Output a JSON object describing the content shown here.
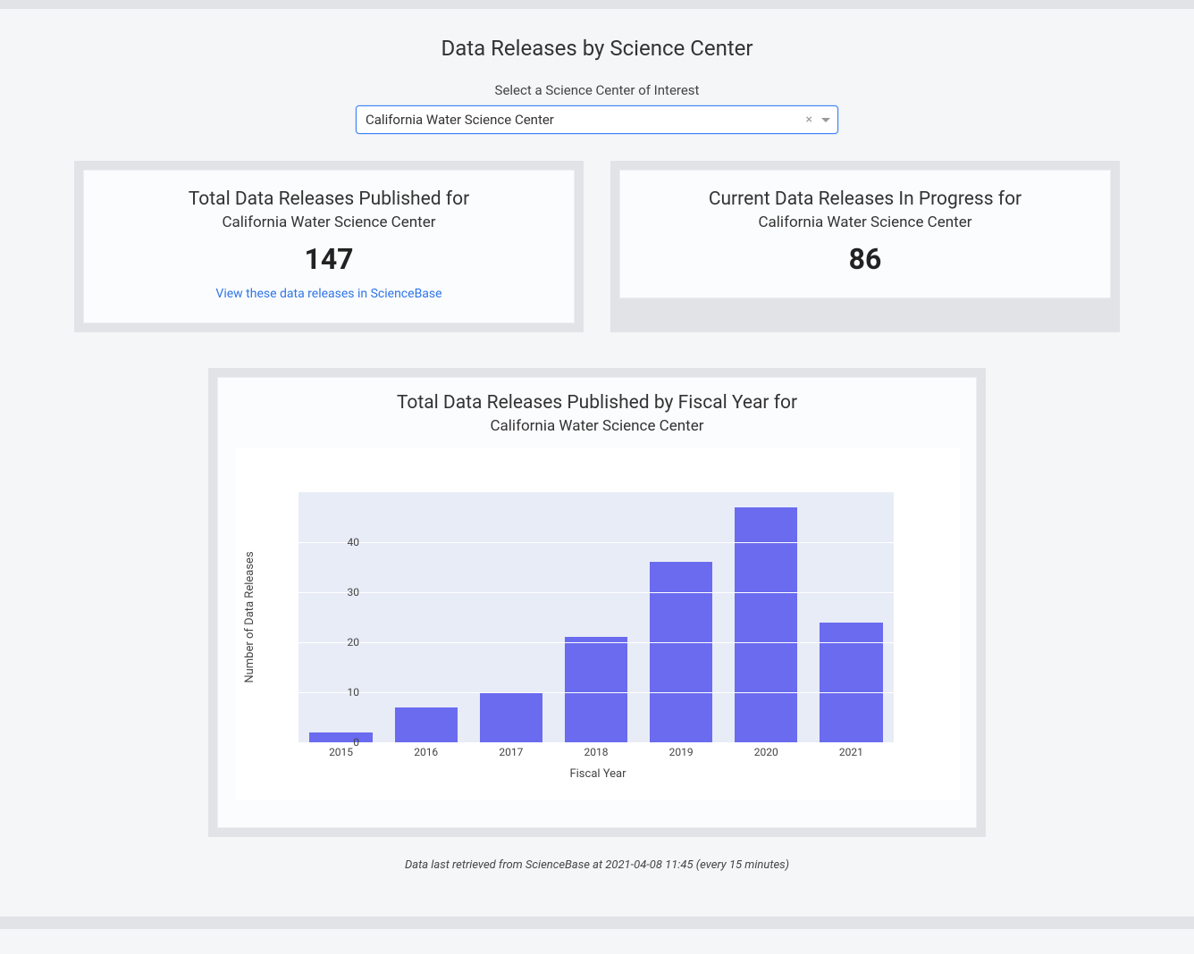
{
  "page": {
    "title": "Data Releases by Science Center",
    "select_label": "Select a Science Center of Interest",
    "selected_center": "California Water Science Center",
    "footer_note": "Data last retrieved from ScienceBase at 2021-04-08 11:45 (every 15 minutes)"
  },
  "cards": {
    "published": {
      "heading": "Total Data Releases Published for",
      "subtitle": "California Water Science Center",
      "value": "147",
      "link_text": "View these data releases in ScienceBase"
    },
    "in_progress": {
      "heading": "Current Data Releases In Progress for",
      "subtitle": "California Water Science Center",
      "value": "86"
    }
  },
  "chart": {
    "heading": "Total Data Releases Published by Fiscal Year for",
    "subtitle": "California Water Science Center"
  },
  "chart_data": {
    "type": "bar",
    "title": "Total Data Releases Published by Fiscal Year for California Water Science Center",
    "categories": [
      "2015",
      "2016",
      "2017",
      "2018",
      "2019",
      "2020",
      "2021"
    ],
    "values": [
      2,
      7,
      10,
      21,
      36,
      47,
      24
    ],
    "xlabel": "Fiscal Year",
    "ylabel": "Number of Data Releases",
    "ylim": [
      0,
      50
    ],
    "yticks": [
      0,
      10,
      20,
      30,
      40
    ],
    "bar_color": "#6a6bef",
    "plot_bg": "#e8ecf7"
  }
}
